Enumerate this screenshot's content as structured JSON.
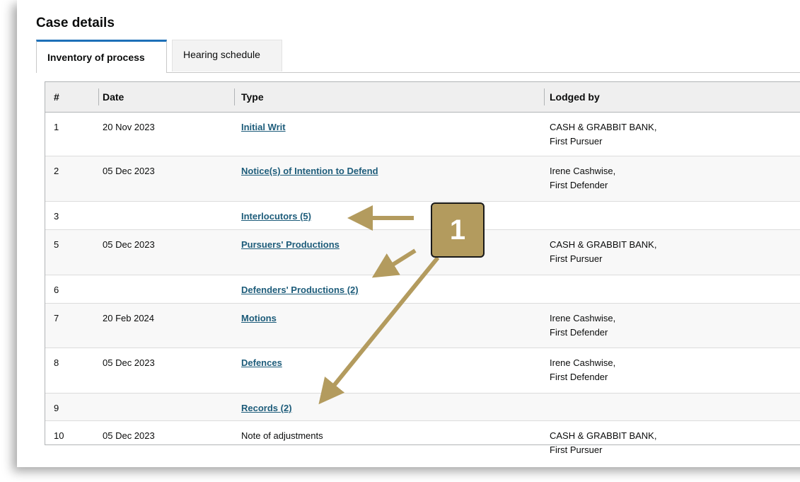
{
  "page": {
    "title": "Case details"
  },
  "tabs": [
    {
      "label": "Inventory of process",
      "active": true
    },
    {
      "label": "Hearing schedule",
      "active": false
    }
  ],
  "table": {
    "headers": [
      "#",
      "Date",
      "Type",
      "Lodged by"
    ],
    "rows": [
      {
        "num": "1",
        "date": "20 Nov 2023",
        "type": "Initial Writ",
        "type_is_link": true,
        "lodged_name": "CASH & GRABBIT BANK,",
        "lodged_role": "First Pursuer"
      },
      {
        "num": "2",
        "date": "05 Dec 2023",
        "type": "Notice(s) of Intention to Defend",
        "type_is_link": true,
        "lodged_name": "Irene Cashwise,",
        "lodged_role": "First Defender"
      },
      {
        "num": "3",
        "date": "",
        "type": "Interlocutors (5)",
        "type_is_link": true,
        "lodged_name": "",
        "lodged_role": ""
      },
      {
        "num": "5",
        "date": "05 Dec 2023",
        "type": "Pursuers' Productions",
        "type_is_link": true,
        "lodged_name": "CASH & GRABBIT BANK,",
        "lodged_role": "First Pursuer"
      },
      {
        "num": "6",
        "date": "",
        "type": "Defenders' Productions (2)",
        "type_is_link": true,
        "lodged_name": "",
        "lodged_role": ""
      },
      {
        "num": "7",
        "date": "20 Feb 2024",
        "type": "Motions",
        "type_is_link": true,
        "lodged_name": "Irene Cashwise,",
        "lodged_role": "First Defender"
      },
      {
        "num": "8",
        "date": "05 Dec 2023",
        "type": "Defences",
        "type_is_link": true,
        "lodged_name": "Irene Cashwise,",
        "lodged_role": "First Defender"
      },
      {
        "num": "9",
        "date": "",
        "type": "Records (2)",
        "type_is_link": true,
        "lodged_name": "",
        "lodged_role": ""
      },
      {
        "num": "10",
        "date": "05 Dec 2023",
        "type": "Note of adjustments",
        "type_is_link": false,
        "lodged_name": "CASH & GRABBIT BANK,",
        "lodged_role": "First Pursuer"
      }
    ]
  },
  "annotation": {
    "label": "1",
    "color": "#b39b5e"
  },
  "colors": {
    "link": "#1d5c7a",
    "active_tab_border": "#1d70b8",
    "header_bg": "#efefef"
  }
}
